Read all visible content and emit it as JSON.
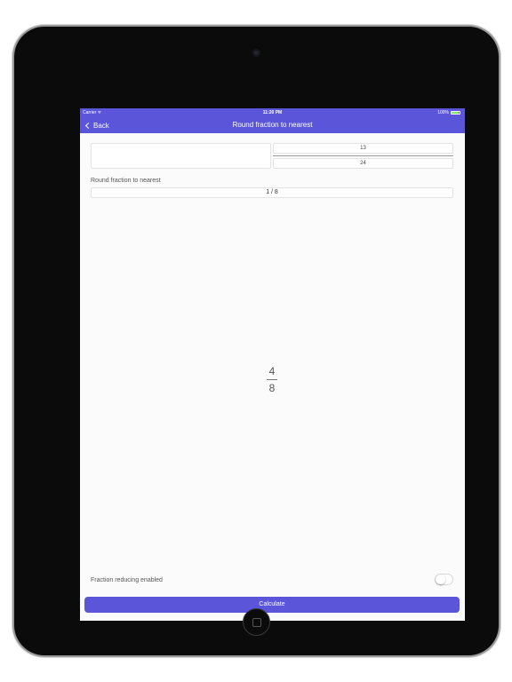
{
  "status_bar": {
    "carrier": "Carrier ᯤ",
    "time": "11:20 PM",
    "battery": "100%"
  },
  "nav": {
    "back_label": "Back",
    "title": "Round fraction to nearest"
  },
  "inputs": {
    "whole_value": "",
    "numerator": "13",
    "denominator": "24",
    "round_label": "Round fraction to nearest",
    "round_value": "1 / 8"
  },
  "result": {
    "numerator": "4",
    "denominator": "8"
  },
  "settings": {
    "reduce_label": "Fraction reducing enabled",
    "reduce_enabled": false
  },
  "actions": {
    "calculate_label": "Calculate"
  },
  "colors": {
    "accent": "#5b55d9",
    "battery": "#7fe36a"
  },
  "icons": {
    "back": "chevron-left-icon",
    "wifi": "wifi-icon",
    "battery": "battery-icon"
  }
}
